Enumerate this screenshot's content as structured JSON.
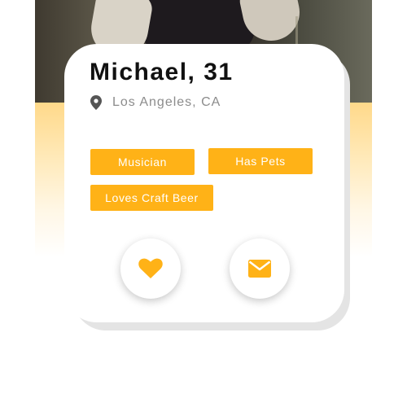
{
  "profile": {
    "name_age": "Michael, 31",
    "location": "Los Angeles, CA",
    "tags": [
      "Musician",
      "Has Pets",
      "Loves Craft Beer"
    ]
  },
  "icons": {
    "location": "map-pin-icon",
    "like": "heart-icon",
    "message": "envelope-icon"
  },
  "colors": {
    "accent": "#ffb217",
    "name_text": "#111111",
    "location_text": "#8c8c8c",
    "band_top": "#ffd98a"
  }
}
